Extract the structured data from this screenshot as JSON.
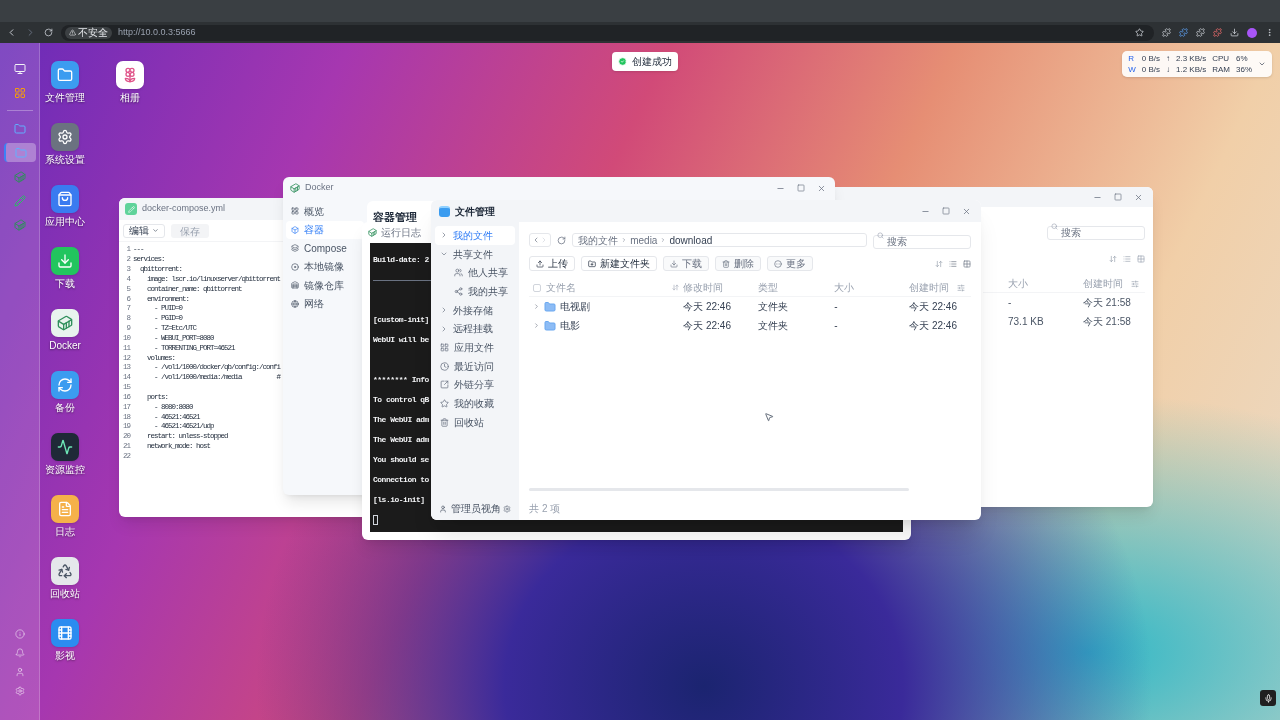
{
  "browser": {
    "security": "不安全",
    "url": "http://10.0.0.3:5666"
  },
  "toast": {
    "text": "创建成功"
  },
  "monitor_widget": {
    "rows": [
      {
        "label": "R",
        "disk": "0 B/s",
        "arrow": "↑",
        "net": "2.3 KB/s",
        "metric": "CPU",
        "value": "6%"
      },
      {
        "label": "W",
        "disk": "0 B/s",
        "arrow": "↓",
        "net": "1.2 KB/s",
        "metric": "RAM",
        "value": "36%"
      }
    ]
  },
  "dock": {
    "items": [
      {
        "kind": "desktop",
        "selected": false
      },
      {
        "kind": "apps",
        "selected": false
      },
      {
        "kind": "files",
        "selected": false
      },
      {
        "kind": "files",
        "selected": true
      },
      {
        "kind": "docker",
        "selected": false
      },
      {
        "kind": "editor",
        "selected": false
      },
      {
        "kind": "docker",
        "selected": false
      }
    ]
  },
  "desktop_icons": {
    "columns": [
      [
        {
          "kind": "files",
          "label": "文件管理"
        },
        {
          "kind": "settings",
          "label": "系统设置"
        },
        {
          "kind": "store",
          "label": "应用中心"
        },
        {
          "kind": "download",
          "label": "下载"
        },
        {
          "kind": "docker",
          "label": "Docker"
        },
        {
          "kind": "backup",
          "label": "备份"
        },
        {
          "kind": "monitor",
          "label": "资源监控"
        },
        {
          "kind": "log",
          "label": "日志"
        },
        {
          "kind": "recycle",
          "label": "回收站"
        },
        {
          "kind": "video",
          "label": "影视"
        }
      ],
      [
        {
          "kind": "photos",
          "label": "相册"
        }
      ]
    ]
  },
  "compose_window": {
    "title": "docker-compose.yml",
    "mode": "编辑",
    "save": "保存",
    "save_disabled": true,
    "lines": [
      {
        "number": "1",
        "text": "---"
      },
      {
        "number": "2",
        "text": "services:"
      },
      {
        "number": "3",
        "text": "  qbittorrent:"
      },
      {
        "number": "4",
        "text": "    image: lscr.io/linuxserver/qbittorrent"
      },
      {
        "number": "5",
        "text": "    container_name: qbittorrent"
      },
      {
        "number": "6",
        "text": "    environment:"
      },
      {
        "number": "7",
        "text": "      - PUID=0"
      },
      {
        "number": "8",
        "text": "      - PGID=0"
      },
      {
        "number": "9",
        "text": "      - TZ=Etc/UTC"
      },
      {
        "number": "10",
        "text": "      - WEBUI_PORT=8080"
      },
      {
        "number": "11",
        "text": "      - TORRENTING_PORT=46521"
      },
      {
        "number": "12",
        "text": "    volumes:"
      },
      {
        "number": "13",
        "text": "      - /vol1/1000/docker/qb/config:/confi"
      },
      {
        "number": "14",
        "text": "      - /vol1/1000/media:/media          #"
      },
      {
        "number": "15"
      },
      {
        "number": "16",
        "text": "    ports:"
      },
      {
        "number": "17",
        "text": "      - 8080:8080"
      },
      {
        "number": "18",
        "text": "      - 46521:46521"
      },
      {
        "number": "19",
        "text": "      - 46521:46521/udp"
      },
      {
        "number": "20",
        "text": "    restart: unless-stopped"
      },
      {
        "number": "21",
        "text": "    network_mode: host"
      },
      {
        "number": "22"
      }
    ]
  },
  "docker_window": {
    "title": "Docker",
    "heading": "容器管理",
    "nav": [
      {
        "label": "概览",
        "kind": "overview",
        "selected": false
      },
      {
        "label": "容器",
        "kind": "containers",
        "selected": true
      },
      {
        "label": "Compose",
        "kind": "compose",
        "selected": false
      },
      {
        "label": "本地镜像",
        "kind": "images",
        "selected": false
      },
      {
        "label": "镜像仓库",
        "kind": "registry",
        "selected": false
      },
      {
        "label": "网络",
        "kind": "network",
        "selected": false
      }
    ]
  },
  "back_files_window": {
    "search_placeholder": "搜索",
    "columns": [
      "大小",
      "创建时间"
    ],
    "rows": [
      [
        "-",
        "今天 21:58"
      ],
      [
        "73.1 KB",
        "今天 21:58"
      ]
    ]
  },
  "log_window": {
    "title": "运行日志",
    "lines": [
      {
        "kind": "text",
        "text": "Build-date: 2"
      },
      {
        "kind": "rule"
      },
      {
        "kind": "blank"
      },
      {
        "kind": "text",
        "text": "[custom-init]"
      },
      {
        "kind": "text",
        "text": "WebUI will be"
      },
      {
        "kind": "blank"
      },
      {
        "kind": "text",
        "text": "******** Info"
      },
      {
        "kind": "text",
        "text": "To control qB"
      },
      {
        "kind": "text",
        "text": "The WebUI adm"
      },
      {
        "kind": "text",
        "text": "The WebUI adm"
      },
      {
        "kind": "text",
        "text": "You should se"
      },
      {
        "kind": "text",
        "text": "Connection to"
      },
      {
        "kind": "text",
        "text": "[ls.io-init]"
      },
      {
        "kind": "cursor"
      }
    ]
  },
  "files_window": {
    "title": "文件管理",
    "sidebar": [
      {
        "label": "我的文件",
        "kind": "group",
        "expanded": false,
        "selected": true
      },
      {
        "label": "共享文件",
        "kind": "group",
        "expanded": true,
        "selected": false,
        "children": [
          {
            "label": "他人共享",
            "kind": "shared-in",
            "selected": false
          },
          {
            "label": "我的共享",
            "kind": "shared-out",
            "selected": false
          }
        ]
      },
      {
        "label": "外接存储",
        "kind": "group",
        "expanded": false,
        "selected": false
      },
      {
        "label": "远程挂载",
        "kind": "group",
        "expanded": false,
        "selected": false
      },
      {
        "label": "应用文件",
        "kind": "apps",
        "selected": false
      },
      {
        "label": "最近访问",
        "kind": "recent",
        "selected": false
      },
      {
        "label": "外链分享",
        "kind": "link",
        "selected": false
      },
      {
        "label": "我的收藏",
        "kind": "favorites",
        "selected": false
      },
      {
        "label": "回收站",
        "kind": "trash",
        "selected": false
      }
    ],
    "footer": "管理员视角",
    "breadcrumb": [
      "我的文件",
      "media",
      "download"
    ],
    "search_placeholder": "搜索",
    "actions": [
      {
        "label": "上传",
        "kind": "upload",
        "disabled": false
      },
      {
        "label": "新建文件夹",
        "kind": "new-folder",
        "disabled": false
      },
      {
        "label": "下载",
        "kind": "download",
        "disabled": true
      },
      {
        "label": "删除",
        "kind": "delete",
        "disabled": true
      },
      {
        "label": "更多",
        "kind": "more",
        "disabled": true
      }
    ],
    "select_all_checked": false,
    "columns": [
      "文件名",
      "修改时间",
      "类型",
      "大小",
      "创建时间"
    ],
    "rows": [
      {
        "name": "电视剧",
        "modified": "今天 22:46",
        "type": "文件夹",
        "size": "-",
        "created": "今天 22:46"
      },
      {
        "name": "电影",
        "modified": "今天 22:46",
        "type": "文件夹",
        "size": "-",
        "created": "今天 22:46"
      }
    ],
    "count": "共 2 项"
  }
}
